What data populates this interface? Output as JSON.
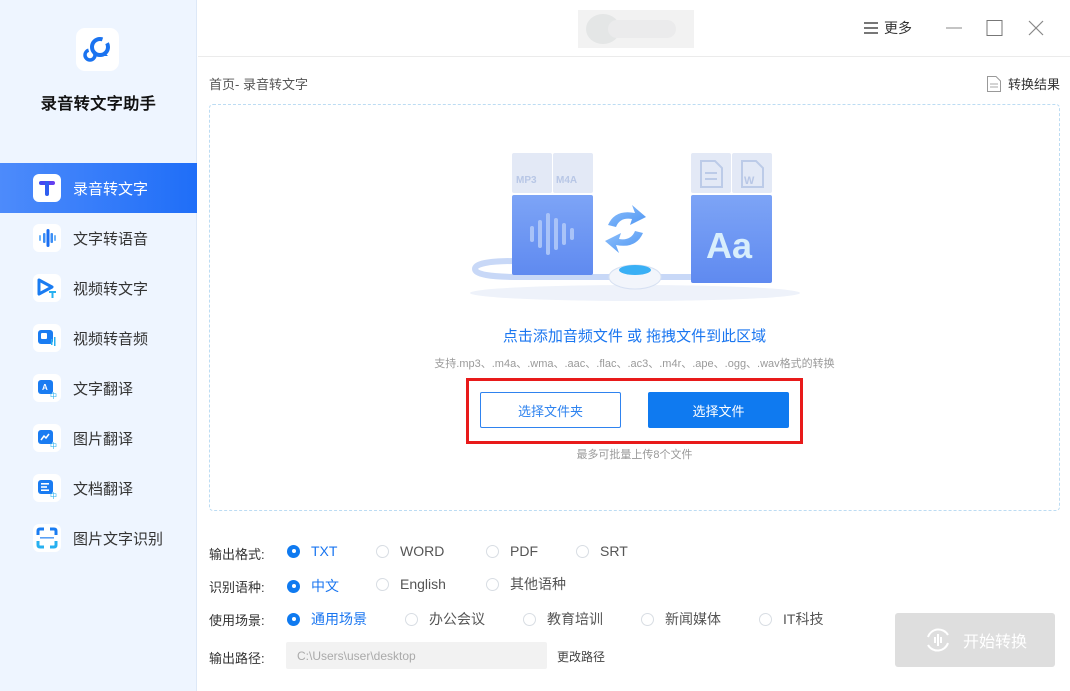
{
  "app": {
    "name": "录音转文字助手",
    "brand_color": "#1f6ef8"
  },
  "sidebar": {
    "items": [
      {
        "label": "录音转文字",
        "icon": "text-t-icon",
        "active": true
      },
      {
        "label": "文字转语音",
        "icon": "soundwave-icon",
        "active": false
      },
      {
        "label": "视频转文字",
        "icon": "video-play-text-icon",
        "active": false
      },
      {
        "label": "视频转音频",
        "icon": "video-audio-icon",
        "active": false
      },
      {
        "label": "文字翻译",
        "icon": "text-translate-icon",
        "active": false
      },
      {
        "label": "图片翻译",
        "icon": "image-translate-icon",
        "active": false
      },
      {
        "label": "文档翻译",
        "icon": "doc-translate-icon",
        "active": false
      },
      {
        "label": "图片文字识别",
        "icon": "scan-ocr-icon",
        "active": false
      }
    ]
  },
  "titlebar": {
    "more_label": "更多"
  },
  "main": {
    "breadcrumb": "首页- 录音转文字",
    "result_link": "转换结果",
    "dropzone": {
      "title": "点击添加音频文件 或 拖拽文件到此区域",
      "supported": "支持.mp3、.m4a、.wma、.aac、.flac、.ac3、.m4r、.ape、.ogg、.wav格式的转换",
      "select_folder": "选择文件夹",
      "select_file": "选择文件",
      "note": "最多可批量上传8个文件",
      "illustration": {
        "left_tags": [
          "MP3",
          "M4A"
        ],
        "right_tags": [
          "doc",
          "W"
        ],
        "right_label": "Aa"
      }
    },
    "options": {
      "format": {
        "label": "输出格式:",
        "options": [
          "TXT",
          "WORD",
          "PDF",
          "SRT"
        ],
        "selected": "TXT"
      },
      "language": {
        "label": "识别语种:",
        "options": [
          "中文",
          "English",
          "其他语种"
        ],
        "selected": "中文"
      },
      "scene": {
        "label": "使用场景:",
        "options": [
          "通用场景",
          "办公会议",
          "教育培训",
          "新闻媒体",
          "IT科技"
        ],
        "selected": "通用场景"
      },
      "output_path": {
        "label": "输出路径:",
        "value": "C:\\Users\\user\\desktop",
        "change_label": "更改路径"
      }
    },
    "start_button": "开始转换"
  }
}
